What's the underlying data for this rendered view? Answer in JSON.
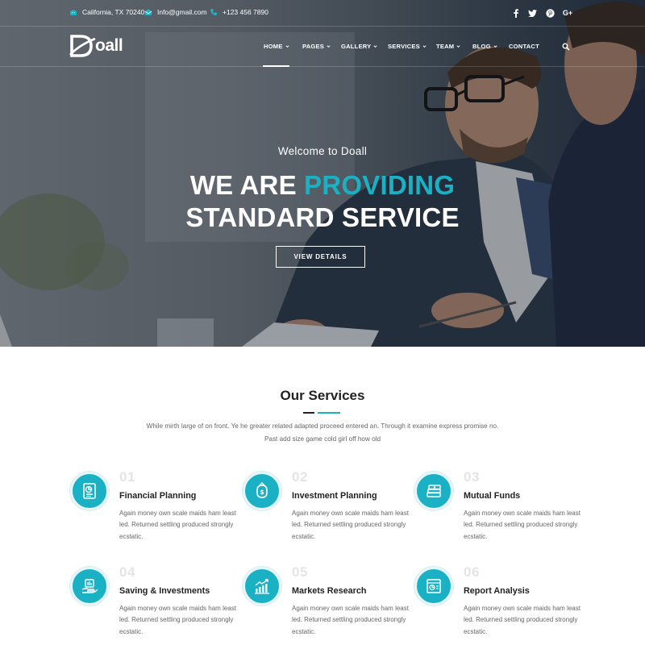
{
  "colors": {
    "accent": "#1bb1c4",
    "dark_text": "#222222",
    "body_text": "#666666",
    "number_text": "#e4e4e4"
  },
  "topbar": {
    "contacts": [
      {
        "icon": "building-icon",
        "text": "California, TX 70240"
      },
      {
        "icon": "mail-icon",
        "text": "Info@gmail.com"
      },
      {
        "icon": "phone-icon",
        "text": "+123 456 7890"
      }
    ],
    "social": [
      {
        "icon": "facebook-icon",
        "glyph": "f"
      },
      {
        "icon": "twitter-icon",
        "glyph": "t"
      },
      {
        "icon": "pinterest-icon",
        "glyph": "p"
      },
      {
        "icon": "google-plus-icon",
        "glyph": "G+"
      }
    ]
  },
  "logo": {
    "text": "oall",
    "icon": "logo-d-icon"
  },
  "nav": {
    "items": [
      {
        "label": "HOME",
        "dropdown": true,
        "active": true
      },
      {
        "label": "PAGES",
        "dropdown": true
      },
      {
        "label": "GALLERY",
        "dropdown": true
      },
      {
        "label": "SERVICES",
        "dropdown": true
      },
      {
        "label": "TEAM",
        "dropdown": true
      },
      {
        "label": "BLOG",
        "dropdown": true
      },
      {
        "label": "CONTACT",
        "dropdown": false
      }
    ],
    "search_icon": "search-icon"
  },
  "hero": {
    "subtitle": "Welcome to Doall",
    "title_line1_plain": "WE ARE ",
    "title_line1_accent": "PROVIDING",
    "title_line2": "STANDARD SERVICE",
    "button": "VIEW DETAILS"
  },
  "services": {
    "title": "Our Services",
    "description_line1": "While mirth large of on front. Ye he greater related adapted proceed entered an. Through it examine express promise no.",
    "description_line2": "Past add size game cold girl off how old",
    "items": [
      {
        "num": "01",
        "title": "Financial Planning",
        "icon": "financial-planning-icon",
        "text": "Again money own scale maids ham least led. Returned settling produced strongly ecstatic."
      },
      {
        "num": "02",
        "title": "Investment Planning",
        "icon": "investment-planning-icon",
        "text": "Again money own scale maids ham least led. Returned settling produced strongly ecstatic."
      },
      {
        "num": "03",
        "title": "Mutual Funds",
        "icon": "mutual-funds-icon",
        "text": "Again money own scale maids ham least led. Returned settling produced strongly ecstatic."
      },
      {
        "num": "04",
        "title": "Saving & Investments",
        "icon": "savings-icon",
        "text": "Again money own scale maids ham least led. Returned settling produced strongly ecstatic."
      },
      {
        "num": "05",
        "title": "Markets Research",
        "icon": "market-research-icon",
        "text": "Again money own scale maids ham least led. Returned settling produced strongly ecstatic."
      },
      {
        "num": "06",
        "title": "Report Analysis",
        "icon": "report-analysis-icon",
        "text": "Again money own scale maids ham least led. Returned settling produced strongly ecstatic."
      }
    ]
  }
}
